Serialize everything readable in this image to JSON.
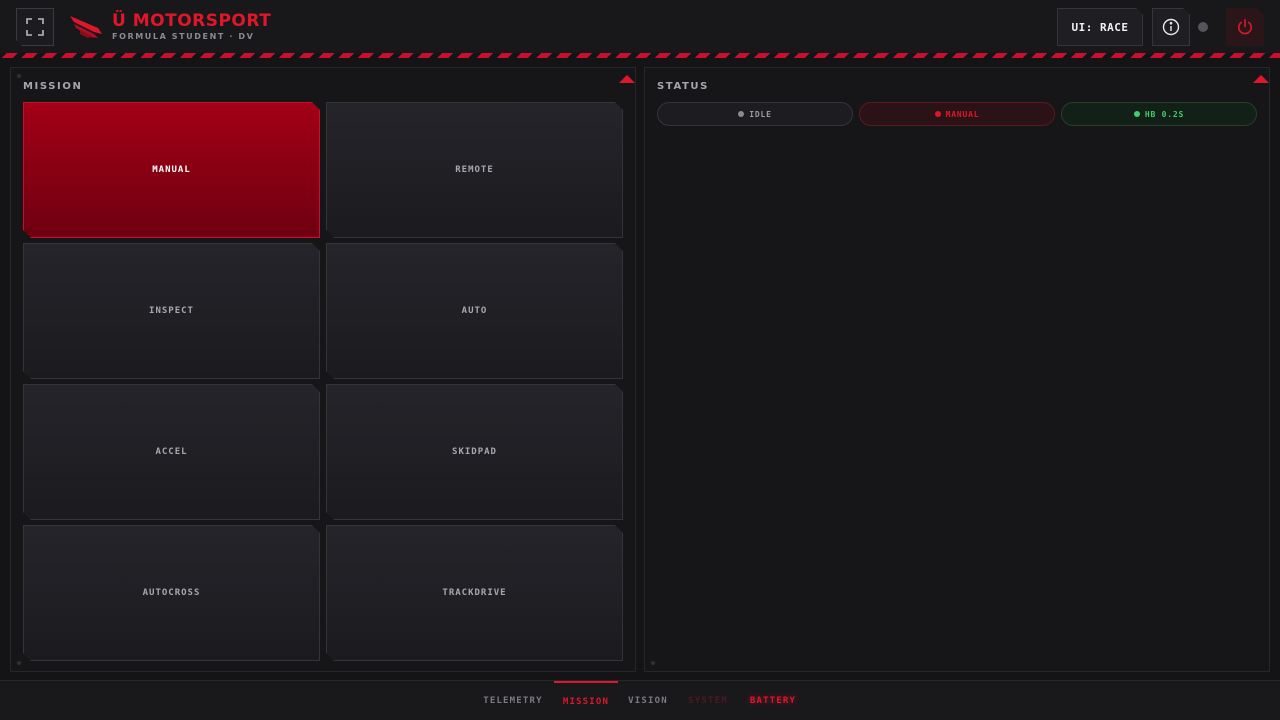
{
  "header": {
    "brand_title": "Ü MOTORSPORT",
    "brand_subtitle": "FORMULA STUDENT · DV",
    "ui_mode": "UI: RACE",
    "icons": {
      "fullscreen": "fullscreen-icon",
      "logo": "logo-mark-icon",
      "info": "info-icon",
      "power": "power-icon"
    },
    "connection_status_color": "#55555b"
  },
  "mission": {
    "title": "MISSION",
    "buttons": [
      {
        "label": "MANUAL",
        "active": true
      },
      {
        "label": "REMOTE",
        "active": false
      },
      {
        "label": "INSPECT",
        "active": false
      },
      {
        "label": "AUTO",
        "active": false
      },
      {
        "label": "ACCEL",
        "active": false
      },
      {
        "label": "SKIDPAD",
        "active": false
      },
      {
        "label": "AUTOCROSS",
        "active": false
      },
      {
        "label": "TRACKDRIVE",
        "active": false
      }
    ]
  },
  "status": {
    "title": "STATUS",
    "pills": [
      {
        "label": "IDLE",
        "kind": "idle"
      },
      {
        "label": "MANUAL",
        "kind": "manual"
      },
      {
        "label": "HB 0.2S",
        "kind": "hb"
      }
    ]
  },
  "nav": {
    "tabs": [
      {
        "label": "TELEMETRY",
        "state": "normal"
      },
      {
        "label": "MISSION",
        "state": "active"
      },
      {
        "label": "VISION",
        "state": "normal"
      },
      {
        "label": "SYSTEM",
        "state": "dim"
      },
      {
        "label": "BATTERY",
        "state": "alert"
      }
    ]
  },
  "colors": {
    "accent": "#e0162b",
    "background": "#141416",
    "ok": "#3fcf6e"
  }
}
